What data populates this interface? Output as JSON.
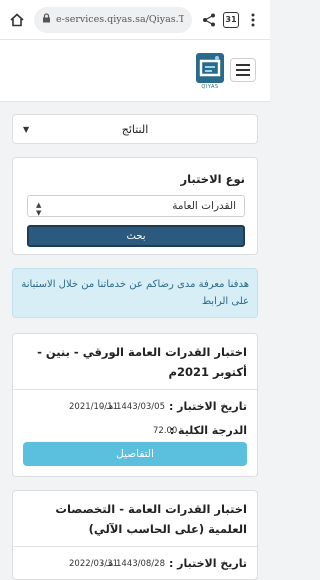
{
  "browser": {
    "url": "e-services.qiyas.sa/Qiyas.T",
    "tabs_count": "31"
  },
  "header": {
    "logo_text": "QIYAS"
  },
  "results_toggle": {
    "label": "النتائج"
  },
  "filter": {
    "title": "نوع الاختبار",
    "selected": "القدرات العامة",
    "search_label": "بحث"
  },
  "survey_alert": {
    "text": "هدفنا معرفة مدى رضاكم عن خدماتنا من خلال الاستبانة على الرابط"
  },
  "results": [
    {
      "title": "اختبار القدرات العامة الورقي - بنين - أكتوبر 2021م",
      "date_label": "تاريخ الاختبار :",
      "hijri_date": "1443/03/05 هـ -",
      "greg_date": "2021/10/11",
      "score_label": "الدرجة الكلية :",
      "score": "72.00",
      "details_label": "التفاصيل"
    },
    {
      "title": "اختبار القدرات العامة - التخصصات العلمية (على الحاسب الآلي)",
      "date_label": "تاريخ الاختبار :",
      "hijri_date": "1443/08/28 هـ -",
      "greg_date": "2022/03/31"
    }
  ],
  "colors": {
    "search_button": "#2c5a7e",
    "details_button": "#5bc0de",
    "alert_background": "#d7eef7",
    "alert_text": "#2d6a86"
  }
}
